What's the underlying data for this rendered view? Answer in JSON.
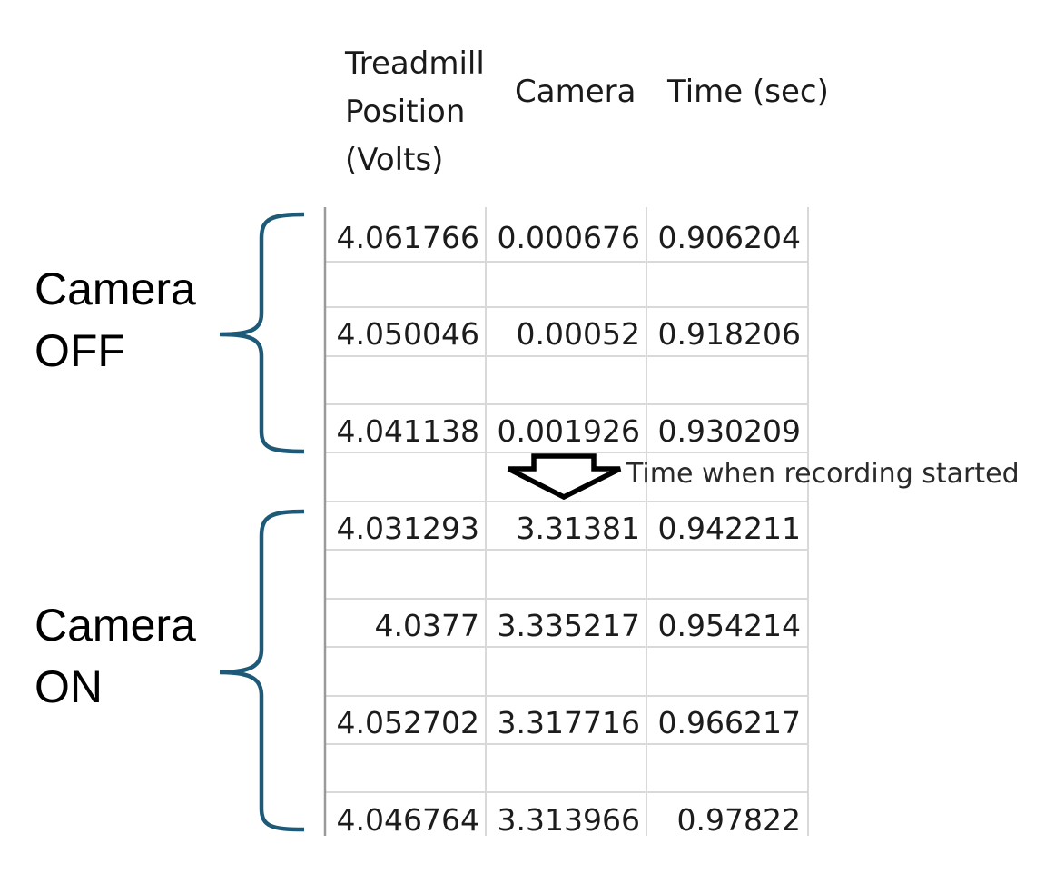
{
  "table": {
    "headers": [
      "Treadmill Position (Volts)",
      "Camera",
      "Time (sec)"
    ],
    "rows": [
      [
        "4.061766",
        "0.000676",
        "0.906204"
      ],
      [
        "4.050046",
        "0.00052",
        "0.918206"
      ],
      [
        "4.041138",
        "0.001926",
        "0.930209"
      ],
      [
        "4.031293",
        "3.31381",
        "0.942211"
      ],
      [
        "4.0377",
        "3.335217",
        "0.954214"
      ],
      [
        "4.052702",
        "3.317716",
        "0.966217"
      ],
      [
        "4.046764",
        "3.313966",
        "0.97822"
      ]
    ]
  },
  "groups": {
    "off_label": "Camera\nOFF",
    "on_label": "Camera\nON"
  },
  "annotation": "Time when recording started",
  "colors": {
    "bracket": "#1e5a78",
    "arrow": "#000000",
    "gridline": "#d9d9d9"
  }
}
